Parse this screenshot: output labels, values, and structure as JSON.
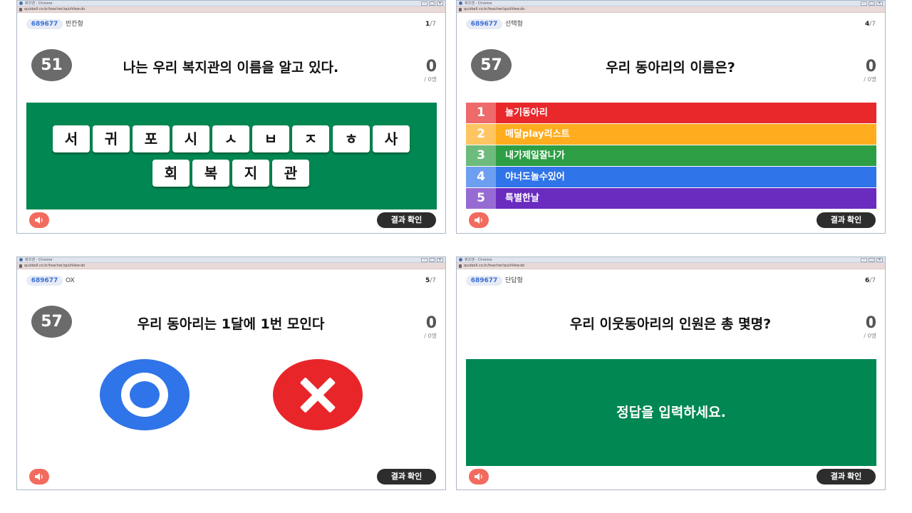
{
  "window": {
    "title": "퀴즈앤 - Chrome",
    "url": "quizbell.co.kr/teacher/quizView.do",
    "controls": [
      "─",
      "□",
      "✕"
    ]
  },
  "common": {
    "pin": "689677",
    "result_button": "결과 확인",
    "score_sub": "/ 0명"
  },
  "panels": [
    {
      "type": "빈칸형",
      "current": "1",
      "total": "/7",
      "timer": "51",
      "question": "나는 우리 복지관의 이름을 알고 있다.",
      "score": "0",
      "tiles_row1": [
        "서",
        "귀",
        "포",
        "시",
        "ㅅ",
        "ㅂ",
        "ㅈ",
        "ㅎ",
        "사"
      ],
      "tiles_row2": [
        "회",
        "복",
        "지",
        "관"
      ]
    },
    {
      "type": "선택형",
      "current": "4",
      "total": "/7",
      "timer": "57",
      "question": "우리 동아리의 이름은?",
      "score": "0",
      "options": [
        {
          "num": "1",
          "text": "놀기동아리",
          "color": "#e8282b",
          "num_color": "#ee6a6b"
        },
        {
          "num": "2",
          "text": "매달play리스트",
          "color": "#ffad1f",
          "num_color": "#ffc562"
        },
        {
          "num": "3",
          "text": "내가제일잘나가",
          "color": "#2e9e45",
          "num_color": "#6dbb7d"
        },
        {
          "num": "4",
          "text": "야너도놀수있어",
          "color": "#2f74e8",
          "num_color": "#6d9ff0"
        },
        {
          "num": "5",
          "text": "특별한날",
          "color": "#6a2bbf",
          "num_color": "#966bd3"
        }
      ]
    },
    {
      "type": "OX",
      "current": "5",
      "total": "/7",
      "timer": "57",
      "question": "우리 동아리는 1달에 1번 모인다",
      "score": "0"
    },
    {
      "type": "단답형",
      "current": "6",
      "total": "/7",
      "question": "우리 이웃동아리의 인원은 총 몇명?",
      "score": "0",
      "answer_prompt": "정답을 입력하세요."
    }
  ]
}
